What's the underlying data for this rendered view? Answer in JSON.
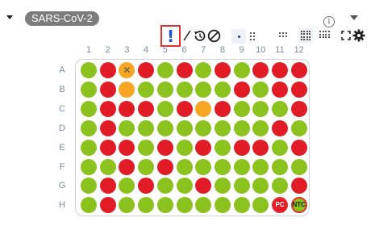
{
  "header": {
    "assay_label": "SARS-CoV-2",
    "info_symbol": "i"
  },
  "toolbar": {
    "alert_symbol": "!",
    "icons": [
      "alert-icon",
      "line-icon",
      "history-icon",
      "disable-icon",
      "dot-size-1-icon",
      "dot-size-2-icon",
      "dot-size-3-icon",
      "grid-96-icon",
      "grid-384-icon",
      "fullscreen-icon",
      "gear-icon"
    ]
  },
  "plate": {
    "columns": [
      "1",
      "2",
      "3",
      "4",
      "5",
      "6",
      "7",
      "8",
      "9",
      "10",
      "11",
      "12"
    ],
    "rows": [
      {
        "label": "A",
        "wells": [
          "green",
          "red",
          "orange-x",
          "red",
          "green",
          "red",
          "green",
          "red",
          "green",
          "red",
          "red",
          "red"
        ]
      },
      {
        "label": "B",
        "wells": [
          "green",
          "red",
          "orange",
          "green",
          "green",
          "green",
          "green",
          "green",
          "red",
          "green",
          "red",
          "red"
        ]
      },
      {
        "label": "C",
        "wells": [
          "green",
          "red",
          "red",
          "red",
          "green",
          "red",
          "orange",
          "red",
          "green",
          "green",
          "green",
          "red"
        ]
      },
      {
        "label": "D",
        "wells": [
          "green",
          "red",
          "green",
          "green",
          "green",
          "green",
          "green",
          "green",
          "green",
          "green",
          "red",
          "green"
        ]
      },
      {
        "label": "E",
        "wells": [
          "green",
          "red",
          "red",
          "green",
          "red",
          "green",
          "red",
          "green",
          "red",
          "red",
          "green",
          "red"
        ]
      },
      {
        "label": "F",
        "wells": [
          "green",
          "green",
          "red",
          "green",
          "red",
          "green",
          "green",
          "green",
          "green",
          "green",
          "green",
          "green"
        ]
      },
      {
        "label": "G",
        "wells": [
          "green",
          "red",
          "green",
          "red",
          "green",
          "green",
          "red",
          "green",
          "green",
          "green",
          "green",
          "red"
        ]
      },
      {
        "label": "H",
        "wells": [
          "green",
          "red",
          "green",
          "green",
          "green",
          "green",
          "green",
          "green",
          "green",
          "green",
          "red-PC",
          "green-NTC"
        ]
      }
    ],
    "colors": {
      "green": "#8cc21e",
      "red": "#e11c27",
      "orange": "#f6a623"
    }
  }
}
